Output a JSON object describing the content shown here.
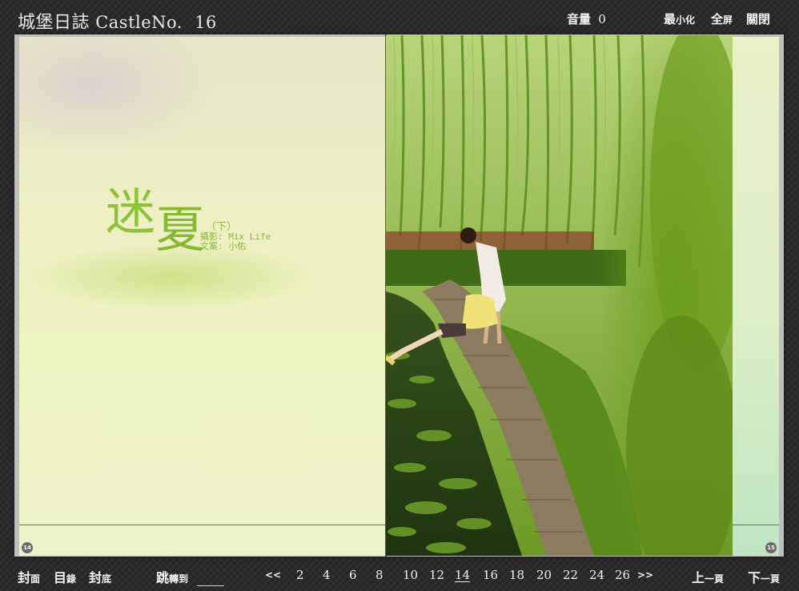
{
  "header": {
    "title_zh": "城堡日誌",
    "title_en": "CastleNo.",
    "issue": "16",
    "volume": {
      "label": "音量",
      "value": "0"
    },
    "minimize": {
      "big": "最",
      "small": "小化"
    },
    "fullscreen": {
      "big": "全",
      "small": "屏"
    },
    "close": "關閉"
  },
  "left_page": {
    "title_char1": "迷",
    "title_char2": "夏",
    "subtitle_mark": "（下）",
    "credit_photo": "攝影: Mix Life",
    "credit_text": "文案: 小佑",
    "page_number": "14"
  },
  "right_page": {
    "page_number": "15"
  },
  "footer": {
    "cover": {
      "big": "封",
      "small": "面"
    },
    "contents": {
      "big": "目",
      "small": "錄"
    },
    "back_cover": {
      "big": "封",
      "small": "底"
    },
    "jump": {
      "big": "跳",
      "small": "轉到"
    },
    "jump_value": "",
    "prev_arrow": "<<",
    "next_arrow": ">>",
    "pages": [
      "2",
      "4",
      "6",
      "8",
      "10",
      "12",
      "14",
      "16",
      "18",
      "20",
      "22",
      "24",
      "26"
    ],
    "current_page": "14",
    "prev_page": {
      "big": "上",
      "small": "一頁"
    },
    "next_page": {
      "big": "下",
      "small": "一頁"
    }
  }
}
